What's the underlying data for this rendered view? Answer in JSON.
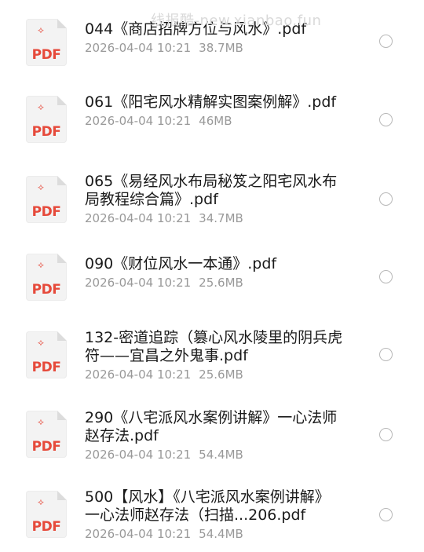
{
  "watermark": "线报酷-new.xianbao.fun",
  "icon": {
    "label": "PDF",
    "glyph_name": "pdf-file-icon"
  },
  "files": [
    {
      "name": "044《商店招牌方位与风水》.pdf",
      "date": "2026-04-04 10:21",
      "size": "38.7MB",
      "selected": false
    },
    {
      "name": "061《阳宅风水精解实图案例解》.pdf",
      "date": "2026-04-04 10:21",
      "size": "46MB",
      "selected": false
    },
    {
      "name": "065《易经风水布局秘笈之阳宅风水布局教程综合篇》.pdf",
      "date": "2026-04-04 10:21",
      "size": "34.7MB",
      "selected": false
    },
    {
      "name": "090《财位风水一本通》.pdf",
      "date": "2026-04-04 10:21",
      "size": "25.6MB",
      "selected": false
    },
    {
      "name": "132-密道追踪（篡心风水陵里的阴兵虎符——宜昌之外鬼事.pdf",
      "date": "2026-04-04 10:21",
      "size": "25.6MB",
      "selected": false
    },
    {
      "name": "290《八宅派风水案例讲解》一心法师赵存法.pdf",
      "date": "2026-04-04 10:21",
      "size": "54.4MB",
      "selected": false
    },
    {
      "name": "500【风水】《八宅派风水案例讲解》一心法师赵存法（扫描...206.pdf",
      "date": "2026-04-04 10:21",
      "size": "54.4MB",
      "selected": false
    }
  ]
}
